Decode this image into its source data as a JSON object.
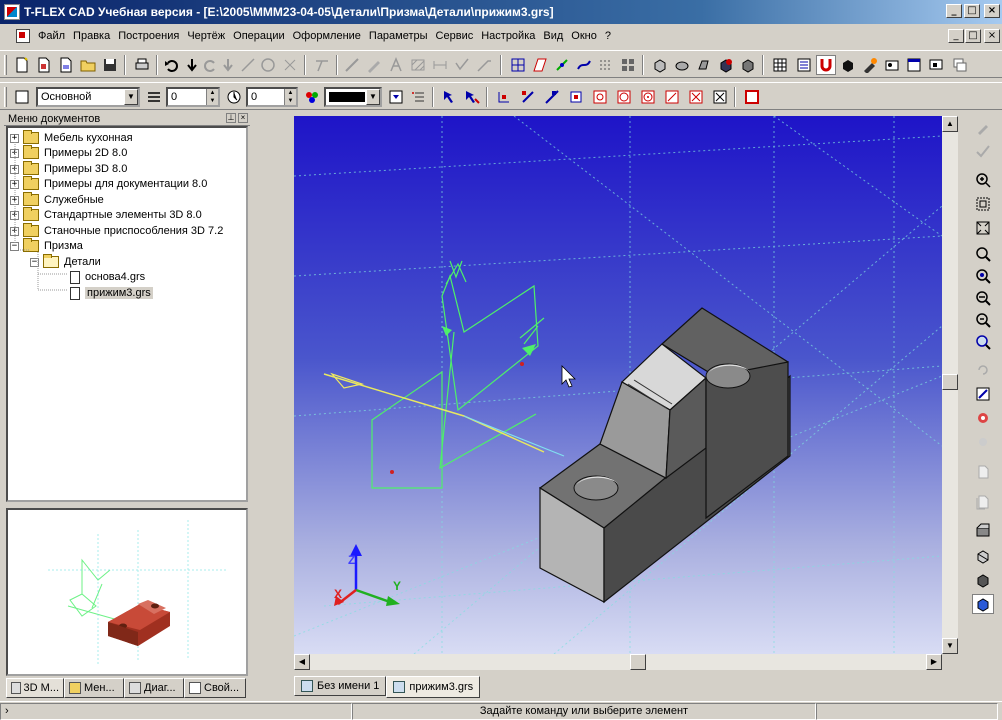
{
  "app": {
    "title": "T-FLEX CAD Учебная версия - [E:\\2005\\МММ23-04-05\\Детали\\Призма\\Детали\\прижим3.grs]"
  },
  "window_controls": {
    "minimize": "_",
    "maximize": "□",
    "close": "×"
  },
  "menu": {
    "items": [
      "Файл",
      "Правка",
      "Построения",
      "Чертёж",
      "Операции",
      "Оформление",
      "Параметры",
      "Сервис",
      "Настройка",
      "Вид",
      "Окно",
      "?"
    ]
  },
  "toolbar2": {
    "layer_value": "Основной",
    "level_value": "0",
    "priority_value": "0",
    "color_value": "#000000"
  },
  "doc_menu": {
    "header": "Меню документов",
    "tree": [
      {
        "label": "Мебель кухонная",
        "expander": "+",
        "type": "folder"
      },
      {
        "label": "Примеры 2D 8.0",
        "expander": "+",
        "type": "folder"
      },
      {
        "label": "Примеры 3D 8.0",
        "expander": "+",
        "type": "folder"
      },
      {
        "label": "Примеры для документации 8.0",
        "expander": "+",
        "type": "folder"
      },
      {
        "label": "Служебные",
        "expander": "+",
        "type": "folder"
      },
      {
        "label": "Стандартные элементы 3D 8.0",
        "expander": "+",
        "type": "folder"
      },
      {
        "label": "Станочные приспособления 3D 7.2",
        "expander": "+",
        "type": "folder"
      },
      {
        "label": "Призма",
        "expander": "−",
        "type": "folder"
      },
      {
        "label": "Детали",
        "expander": "−",
        "type": "folder-open"
      },
      {
        "label": "основа4.grs",
        "expander": "",
        "type": "file"
      },
      {
        "label": "прижим3.grs",
        "expander": "",
        "type": "file",
        "selected": true
      }
    ]
  },
  "left_tabs": [
    {
      "label": "3D М...",
      "active": true
    },
    {
      "label": "Мен...",
      "active": false
    },
    {
      "label": "Диаг...",
      "active": false
    },
    {
      "label": "Свой...",
      "active": false
    }
  ],
  "doc_tabs": [
    {
      "label": "Без имени 1",
      "active": false
    },
    {
      "label": "прижим3.grs",
      "active": true
    }
  ],
  "axes": {
    "x": "X",
    "y": "Y",
    "z": "Z"
  },
  "statusbar": {
    "left": "",
    "message": "Задайте команду или выберите элемент"
  },
  "colors": {
    "titlebar": "#0a246a",
    "viewport_top": "#1e14c8",
    "viewport_bottom": "#d8dcf4",
    "sketch_green": "#40e060",
    "part_grey": "#5a5a5a"
  }
}
